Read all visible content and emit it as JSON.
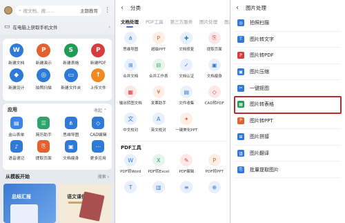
{
  "panel1": {
    "search_placeholder": "搜文档、搜……",
    "header_button": "主题教育",
    "banner_text": "在电脑上获取手机文件",
    "create_items": [
      {
        "label": "新建文档",
        "glyph": "W",
        "color": "#2f7ad9",
        "icon": "word-doc-icon"
      },
      {
        "label": "新建演示",
        "glyph": "P",
        "color": "#e2612f",
        "icon": "presentation-icon"
      },
      {
        "label": "新建表格",
        "glyph": "S",
        "color": "#1f9d55",
        "icon": "spreadsheet-icon"
      },
      {
        "label": "新建PDF",
        "glyph": "P",
        "color": "#d73b3b",
        "icon": "pdf-icon"
      },
      {
        "label": "新建设计",
        "glyph": "◆",
        "color": "#2f7ad9",
        "icon": "design-icon"
      },
      {
        "label": "拍照扫描",
        "glyph": "◎",
        "color": "#2f7ad9",
        "icon": "camera-scan-icon"
      },
      {
        "label": "新建文件夹",
        "glyph": "▭",
        "color": "#2f7ad9",
        "icon": "folder-icon"
      },
      {
        "label": "上传文件",
        "glyph": "↑",
        "color": "#f08a24",
        "icon": "upload-icon"
      }
    ],
    "apps_title": "应用",
    "apps_more": "收起 ⌃",
    "apps": [
      {
        "label": "金山表单",
        "glyph": "▤",
        "color": "#3e84e6",
        "icon": "form-icon"
      },
      {
        "label": "简历助手",
        "glyph": "☰",
        "color": "#2fa36b",
        "icon": "resume-icon"
      },
      {
        "label": "思维导图",
        "glyph": "⋔",
        "color": "#2f7ad9",
        "icon": "mind-map-icon"
      },
      {
        "label": "CAD编辑",
        "glyph": "◇",
        "color": "#2f7ad9",
        "icon": "cad-icon"
      },
      {
        "label": "语音速记",
        "glyph": "♪",
        "color": "#2f7ad9",
        "icon": "voice-note-icon"
      },
      {
        "label": "提取页面",
        "glyph": "⎘",
        "color": "#e2612f",
        "icon": "extract-page-icon"
      },
      {
        "label": "文档瘦身",
        "glyph": "▣",
        "color": "#2f7ad9",
        "icon": "doc-slim-icon"
      },
      {
        "label": "更多应用",
        "glyph": "⋯",
        "color": "#2f7ad9",
        "icon": "more-apps-icon"
      }
    ],
    "templates_title": "从模板开始",
    "templates_more": "搜索 ›",
    "template1_title": "总结汇报",
    "template2_title": "语文课件"
  },
  "panel2": {
    "title": "分类",
    "tabs": [
      "文档处理",
      "PDF工具",
      "第三方服务",
      "图片处理",
      "图片扫描"
    ],
    "doc_tools": [
      {
        "label": "思维导图",
        "glyph": "⋔",
        "color": "#2f7ad9",
        "bg": "#e8f0fc",
        "icon": "mind-map-icon"
      },
      {
        "label": "超级PPT",
        "glyph": "P",
        "color": "#e2612f",
        "bg": "#fdeee6",
        "icon": "super-ppt-icon"
      },
      {
        "label": "文档修复",
        "glyph": "✚",
        "color": "#2f7ad9",
        "bg": "#e8f0fc",
        "icon": "doc-repair-icon"
      },
      {
        "label": "提取页面",
        "glyph": "⎘",
        "color": "#d73b3b",
        "bg": "#fde8e8",
        "icon": "extract-page-icon"
      },
      {
        "label": "合并文档",
        "glyph": "⊞",
        "color": "#2f7ad9",
        "bg": "#e8f0fc",
        "icon": "merge-doc-icon"
      },
      {
        "label": "合并工作表",
        "glyph": "⊟",
        "color": "#1f9d55",
        "bg": "#e6f5ec",
        "icon": "merge-sheet-icon"
      },
      {
        "label": "文档认证",
        "glyph": "✓",
        "color": "#2f7ad9",
        "bg": "#e8f0fc",
        "icon": "doc-verify-icon"
      },
      {
        "label": "文档瘦身",
        "glyph": "▣",
        "color": "#2f7ad9",
        "bg": "#e8f0fc",
        "icon": "doc-slim-icon"
      },
      {
        "label": "输出转图文档",
        "glyph": "▦",
        "color": "#d73b3b",
        "bg": "#fde8e8",
        "icon": "export-image-doc-icon"
      },
      {
        "label": "发票助手",
        "glyph": "¥",
        "color": "#e2612f",
        "bg": "#fdeee6",
        "icon": "invoice-icon"
      },
      {
        "label": "文件收集",
        "glyph": "▤",
        "color": "#2f7ad9",
        "bg": "#e8f0fc",
        "icon": "file-collect-icon"
      },
      {
        "label": "CAD转PDF",
        "glyph": "◇",
        "color": "#d73b3b",
        "bg": "#fde8e8",
        "icon": "cad-to-pdf-icon"
      },
      {
        "label": "中文校对",
        "glyph": "文",
        "color": "#2f7ad9",
        "bg": "#e8f0fc",
        "icon": "chinese-proof-icon"
      },
      {
        "label": "英文校对",
        "glyph": "A",
        "color": "#2f7ad9",
        "bg": "#e8f0fc",
        "icon": "english-proof-icon"
      },
      {
        "label": "一键美化PPT",
        "glyph": "✦",
        "color": "#e2612f",
        "bg": "#fdeee6",
        "icon": "beautify-ppt-icon"
      }
    ],
    "pdf_title": "PDF工具",
    "pdf_tools": [
      {
        "label": "PDF转Word",
        "glyph": "W",
        "color": "#2f7ad9",
        "bg": "#e8f0fc",
        "icon": "pdf-to-word-icon"
      },
      {
        "label": "PDF转Excel",
        "glyph": "X",
        "color": "#1f9d55",
        "bg": "#e6f5ec",
        "icon": "pdf-to-excel-icon"
      },
      {
        "label": "PDF编辑",
        "glyph": "✎",
        "color": "#d73b3b",
        "bg": "#fde8e8",
        "icon": "pdf-edit-icon"
      },
      {
        "label": "PDF转PPT",
        "glyph": "P",
        "color": "#e2612f",
        "bg": "#fdeee6",
        "icon": "pdf-to-ppt-icon"
      },
      {
        "label": "",
        "glyph": "T",
        "color": "#2f7ad9",
        "bg": "#e8f0fc",
        "icon": "pdf-text-icon"
      },
      {
        "label": "",
        "glyph": "▥",
        "color": "#2f7ad9",
        "bg": "#e8f0fc",
        "icon": "pdf-page-icon"
      },
      {
        "label": "",
        "glyph": "≡",
        "color": "#2f7ad9",
        "bg": "#e8f0fc",
        "icon": "pdf-list-icon"
      },
      {
        "label": "",
        "glyph": "⊕",
        "color": "#2f7ad9",
        "bg": "#e8f0fc",
        "icon": "pdf-more-icon"
      }
    ]
  },
  "panel3": {
    "title": "图片处理",
    "items": [
      {
        "label": "拍照扫描",
        "glyph": "◎",
        "color": "#2f7ad9",
        "icon": "camera-scan-icon",
        "highlight": false
      },
      {
        "label": "图片转文字",
        "glyph": "T",
        "color": "#2f7ad9",
        "icon": "image-to-text-icon",
        "highlight": false
      },
      {
        "label": "图片转PDF",
        "glyph": "P",
        "color": "#d73b3b",
        "icon": "image-to-pdf-icon",
        "highlight": false
      },
      {
        "label": "图片压缩",
        "glyph": "▣",
        "color": "#2f7ad9",
        "icon": "image-compress-icon",
        "highlight": false
      },
      {
        "label": "一键抠图",
        "glyph": "✂",
        "color": "#2f7ad9",
        "icon": "cutout-icon",
        "highlight": false
      },
      {
        "label": "图片转表格",
        "glyph": "▦",
        "color": "#1f9d55",
        "icon": "image-to-table-icon",
        "highlight": true
      },
      {
        "label": "图片转PPT",
        "glyph": "P",
        "color": "#e2612f",
        "icon": "image-to-ppt-icon",
        "highlight": false
      },
      {
        "label": "图片拼接",
        "glyph": "⊞",
        "color": "#2f7ad9",
        "icon": "image-stitch-icon",
        "highlight": false
      },
      {
        "label": "图片翻译",
        "glyph": "译",
        "color": "#2f7ad9",
        "icon": "image-translate-icon",
        "highlight": false
      },
      {
        "label": "批量提取图片",
        "glyph": "⎘",
        "color": "#2f7ad9",
        "icon": "batch-extract-icon",
        "highlight": false
      }
    ]
  },
  "colors": {
    "highlight_border": "#c0282a",
    "accent": "#2e6fe0"
  }
}
